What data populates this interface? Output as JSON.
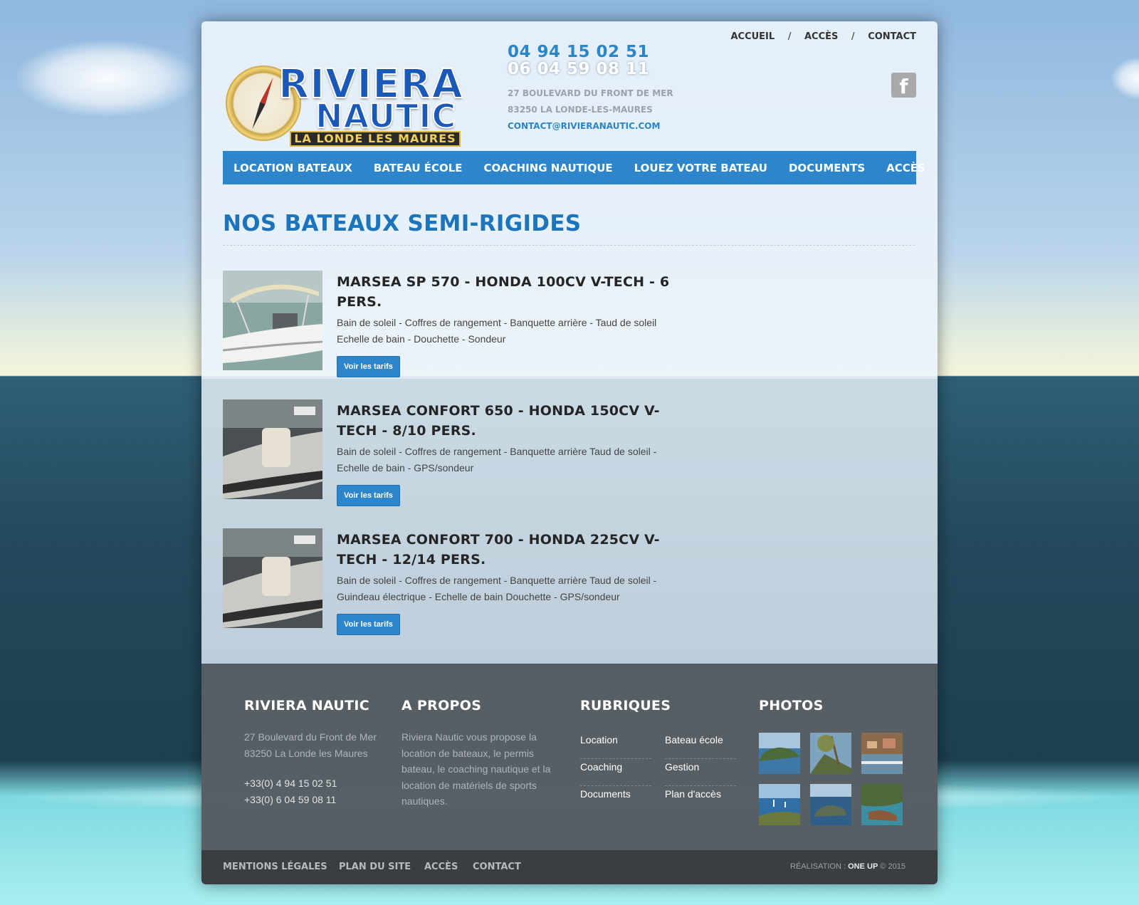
{
  "site": {
    "logo": {
      "line1": "RIVIERA",
      "line2": "NAUTIC",
      "band": "LA LONDE LES MAURES"
    },
    "phones": [
      "04 94 15 02 51",
      "06 04 59 08 11"
    ],
    "address_lines": [
      "27 BOULEVARD DU FRONT DE MER",
      "83250 LA LONDE-LES-MAURES"
    ],
    "email": "CONTACT@RIVIERANAUTIC.COM",
    "social_icon_glyph": "f"
  },
  "topnav": [
    "ACCUEIL",
    "ACCÈS",
    "CONTACT"
  ],
  "topnav_separator": "/",
  "mainnav": [
    "LOCATION BATEAUX",
    "BATEAU ÉCOLE",
    "COACHING NAUTIQUE",
    "LOUEZ VOTRE BATEAU",
    "DOCUMENTS",
    "ACCÈS"
  ],
  "page_title": "NOS BATEAUX SEMI-RIGIDES",
  "boats": [
    {
      "name": "MARSEA SP 570 - HONDA 100CV V-TECH - 6 PERS.",
      "description": "Bain de soleil - Coffres de rangement - Banquette arrière - Taud de soleil Echelle de bain - Douchette - Sondeur",
      "button": "Voir les tarifs"
    },
    {
      "name": "MARSEA CONFORT 650 - HONDA 150CV V-TECH - 8/10 PERS.",
      "description": "Bain de soleil - Coffres de rangement - Banquette arrière Taud de soleil - Echelle de bain - GPS/sondeur",
      "button": "Voir les tarifs"
    },
    {
      "name": "MARSEA CONFORT 700 - HONDA 225CV V-TECH - 12/14 PERS.",
      "description": "Bain de soleil - Coffres de rangement - Banquette arrière Taud de soleil - Guindeau électrique - Echelle de bain Douchette - GPS/sondeur",
      "button": "Voir les tarifs"
    }
  ],
  "footer": {
    "col1": {
      "title": "RIVIERA NAUTIC",
      "address": [
        "27 Boulevard du Front de Mer",
        "83250 La Londe les Maures"
      ],
      "phones": [
        "+33(0) 4 94 15 02 51",
        "+33(0) 6 04 59 08 11"
      ]
    },
    "col2": {
      "title": "A PROPOS",
      "text": "Riviera Nautic vous propose la location de bateaux, le permis bateau, le coaching nautique et la location de matériels de sports nautiques."
    },
    "col3": {
      "title": "RUBRIQUES",
      "links": [
        "Location",
        "Bateau école",
        "Coaching",
        "Gestion",
        "Documents",
        "Plan d'accès"
      ]
    },
    "col4": {
      "title": "PHOTOS"
    }
  },
  "bottom": {
    "links": [
      "MENTIONS LÉGALES",
      "PLAN DU SITE",
      "ACCÈS",
      "CONTACT"
    ],
    "credit_label": "RÉALISATION :",
    "credit_name": "ONE UP",
    "credit_year": "© 2015"
  }
}
